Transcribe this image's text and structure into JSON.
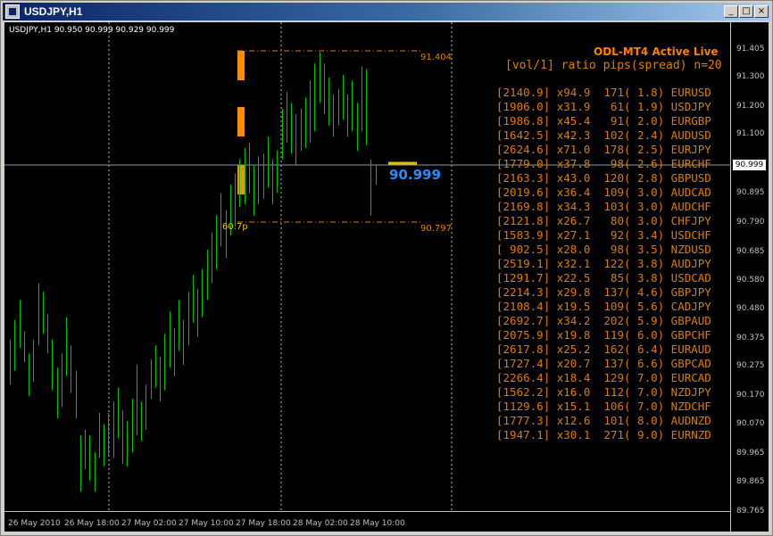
{
  "window": {
    "title": "USDJPY,H1",
    "controls": [
      "_",
      "□",
      "×"
    ]
  },
  "chart": {
    "symbol_info": "USDJPY,H1  90.950 90.999 90.929 90.999",
    "current_price": "90.999",
    "big_price": "90.999",
    "high_label": "91.404",
    "low_label": "90.797",
    "range_label": "60.7p",
    "price_axis": [
      "91.405",
      "91.300",
      "91.200",
      "91.100",
      "90.999",
      "90.895",
      "90.790",
      "90.685",
      "90.580",
      "90.480",
      "90.375",
      "90.275",
      "90.170",
      "90.070",
      "89.965",
      "89.865",
      "89.765"
    ],
    "time_axis": [
      "26 May 2010",
      "26 May 18:00",
      "27 May 02:00",
      "27 May 10:00",
      "27 May 18:00",
      "28 May 02:00",
      "28 May 10:00"
    ],
    "colors": {
      "background": "#000000",
      "bars": "#00c000",
      "grid": "#c0c0c0",
      "panel_text": "#e07a00",
      "big_price": "#1e90ff"
    }
  },
  "panel": {
    "title": "ODL-MT4 Active Live",
    "header": "[vol/1] ratio pips(spread) n=20",
    "rows": [
      "[2140.9] x94.9  171( 1.8) EURUSD",
      "[1906.0] x31.9   61( 1.9) USDJPY",
      "[1986.8] x45.4   91( 2.0) EURGBP",
      "[1642.5] x42.3  102( 2.4) AUDUSD",
      "[2624.6] x71.0  178( 2.5) EURJPY",
      "[1779.0] x37.8   98( 2.6) EURCHF",
      "[2163.3] x43.0  120( 2.8) GBPUSD",
      "[2019.6] x36.4  109( 3.0) AUDCAD",
      "[2169.8] x34.3  103( 3.0) AUDCHF",
      "[2121.8] x26.7   80( 3.0) CHFJPY",
      "[1583.9] x27.1   92( 3.4) USDCHF",
      "[ 902.5] x28.0   98( 3.5) NZDUSD",
      "[2519.1] x32.1  122( 3.8) AUDJPY",
      "[1291.7] x22.5   85( 3.8) USDCAD",
      "[2214.3] x29.8  137( 4.6) GBPJPY",
      "[2108.4] x19.5  109( 5.6) CADJPY",
      "[2692.7] x34.2  202( 5.9) GBPAUD",
      "[2075.9] x19.8  119( 6.0) GBPCHF",
      "[2617.8] x25.2  162( 6.4) EURAUD",
      "[1727.4] x20.7  137( 6.6) GBPCAD",
      "[2266.4] x18.4  129( 7.0) EURCAD",
      "[1562.2] x16.0  112( 7.0) NZDJPY",
      "[1129.6] x15.1  106( 7.0) NZDCHF",
      "[1777.3] x12.6  101( 8.0) AUDNZD",
      "[1947.1] x30.1  271( 9.0) EURNZD"
    ]
  },
  "chart_data": {
    "type": "bar",
    "series": [
      {
        "values": [
          [
            90.22,
            90.38
          ],
          [
            90.27,
            90.45
          ],
          [
            90.35,
            90.52
          ],
          [
            90.3,
            90.41
          ],
          [
            90.18,
            90.33
          ],
          [
            90.23,
            90.38
          ],
          [
            90.36,
            90.58
          ],
          [
            90.4,
            90.55
          ],
          [
            90.33,
            90.47
          ],
          [
            90.2,
            90.38
          ],
          [
            90.1,
            90.28
          ],
          [
            90.14,
            90.33
          ],
          [
            90.25,
            90.46
          ],
          [
            90.19,
            90.36
          ],
          [
            90.1,
            90.27
          ],
          [
            89.84,
            90.04
          ],
          [
            89.92,
            90.06
          ],
          [
            89.88,
            90.04
          ],
          [
            89.84,
            89.98
          ],
          [
            89.96,
            90.12
          ],
          [
            89.93,
            90.08
          ],
          [
            89.97,
            90.12
          ],
          [
            89.96,
            90.16
          ],
          [
            90.03,
            90.21
          ],
          [
            89.94,
            90.13
          ],
          [
            89.93,
            90.09
          ],
          [
            89.98,
            90.17
          ],
          [
            90.04,
            90.29
          ],
          [
            90.02,
            90.16
          ],
          [
            90.06,
            90.22
          ],
          [
            90.17,
            90.31
          ],
          [
            90.21,
            90.36
          ],
          [
            90.16,
            90.32
          ],
          [
            90.2,
            90.4
          ],
          [
            90.28,
            90.48
          ],
          [
            90.25,
            90.42
          ],
          [
            90.34,
            90.52
          ],
          [
            90.29,
            90.45
          ],
          [
            90.36,
            90.55
          ],
          [
            90.44,
            90.61
          ],
          [
            90.39,
            90.56
          ],
          [
            90.46,
            90.63
          ],
          [
            90.52,
            90.7
          ],
          [
            90.58,
            90.76
          ],
          [
            90.63,
            90.82
          ],
          [
            90.71,
            90.9
          ],
          [
            90.67,
            90.84
          ],
          [
            90.75,
            90.93
          ],
          [
            90.78,
            90.97
          ],
          [
            90.85,
            91.02
          ],
          [
            90.86,
            91.06
          ],
          [
            90.9,
            91.08
          ],
          [
            90.82,
            91.0
          ],
          [
            90.86,
            91.03
          ],
          [
            90.88,
            91.04
          ],
          [
            90.92,
            91.1
          ],
          [
            90.86,
            91.02
          ],
          [
            90.9,
            91.05
          ],
          [
            91.02,
            91.2
          ],
          [
            91.08,
            91.26
          ],
          [
            91.04,
            91.22
          ],
          [
            91.0,
            91.18
          ],
          [
            91.05,
            91.2
          ],
          [
            91.06,
            91.24
          ],
          [
            91.08,
            91.3
          ],
          [
            91.12,
            91.36
          ],
          [
            91.22,
            91.4
          ],
          [
            91.18,
            91.36
          ],
          [
            91.14,
            91.31
          ],
          [
            91.1,
            91.25
          ],
          [
            91.14,
            91.27
          ],
          [
            91.16,
            91.32
          ],
          [
            91.1,
            91.25
          ],
          [
            91.12,
            91.3
          ],
          [
            91.05,
            91.22
          ],
          [
            91.12,
            91.35
          ],
          [
            91.07,
            91.34
          ],
          [
            90.82,
            91.02
          ],
          [
            90.93,
            91.0
          ]
        ]
      }
    ],
    "ylim": [
      89.765,
      91.405
    ]
  }
}
